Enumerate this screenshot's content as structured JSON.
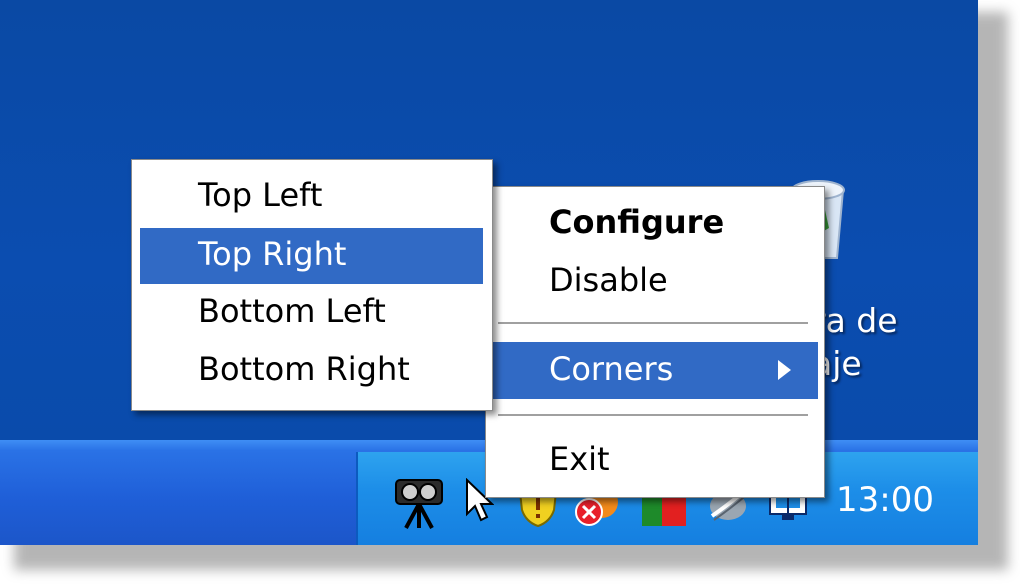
{
  "submenu": {
    "items": [
      {
        "label": "Top Left"
      },
      {
        "label": "Top Right"
      },
      {
        "label": "Bottom Left"
      },
      {
        "label": "Bottom Right"
      }
    ],
    "selected_index": 1
  },
  "context_menu": {
    "configure": "Configure",
    "disable": "Disable",
    "corners": "Corners",
    "exit": "Exit"
  },
  "desktop": {
    "recycle_bin_label_line1": "ra de",
    "recycle_bin_label_line2": "aje"
  },
  "taskbar": {
    "clock": "13:00",
    "tray_icons": [
      "webcam-icon",
      "mouse-pointer-icon",
      "security-shield-icon",
      "alert-icon",
      "network-icon",
      "safely-remove-icon",
      "display-icon"
    ]
  },
  "colors": {
    "desktop": "#0b4db0",
    "taskbar": "#1f5fd8",
    "tray": "#1d8ee8",
    "selection": "#316ac5",
    "menu_bg": "#ffffff"
  }
}
